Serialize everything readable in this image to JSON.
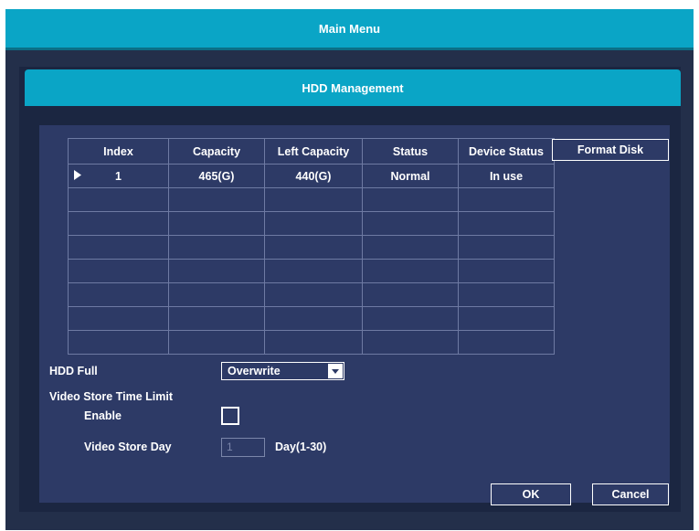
{
  "main_title": "Main Menu",
  "dialog_title": "HDD Management",
  "table": {
    "headers": [
      "Index",
      "Capacity",
      "Left Capacity",
      "Status",
      "Device Status"
    ],
    "rows": [
      [
        "1",
        "465(G)",
        "440(G)",
        "Normal",
        "In use"
      ],
      [
        "",
        "",
        "",
        "",
        ""
      ],
      [
        "",
        "",
        "",
        "",
        ""
      ],
      [
        "",
        "",
        "",
        "",
        ""
      ],
      [
        "",
        "",
        "",
        "",
        ""
      ],
      [
        "",
        "",
        "",
        "",
        ""
      ],
      [
        "",
        "",
        "",
        "",
        ""
      ],
      [
        "",
        "",
        "",
        "",
        ""
      ]
    ]
  },
  "format_disk_label": "Format Disk",
  "hdd_full": {
    "label": "HDD Full",
    "value": "Overwrite"
  },
  "video_store_time_limit": {
    "label": "Video Store Time Limit",
    "enable_label": "Enable",
    "enable_checked": false,
    "store_day_label": "Video Store Day",
    "store_day_value": "1",
    "store_day_range": "Day(1-30)"
  },
  "buttons": {
    "ok": "OK",
    "cancel": "Cancel"
  },
  "colors": {
    "accent": "#0aa5c6",
    "panel": "#2d3a66",
    "background": "#232f4a"
  }
}
